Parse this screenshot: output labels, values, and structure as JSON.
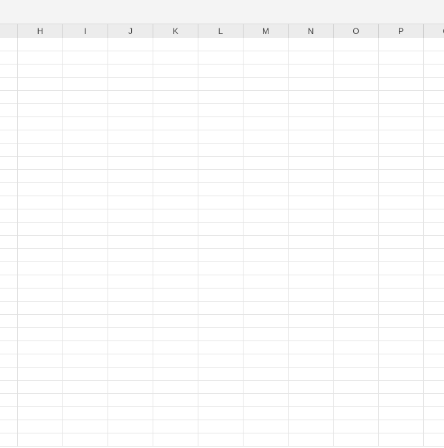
{
  "spreadsheet": {
    "columnHeaders": [
      "H",
      "I",
      "J",
      "K",
      "L",
      "M",
      "N",
      "O",
      "P",
      "Q"
    ],
    "visibleRows": 31,
    "cells": []
  }
}
